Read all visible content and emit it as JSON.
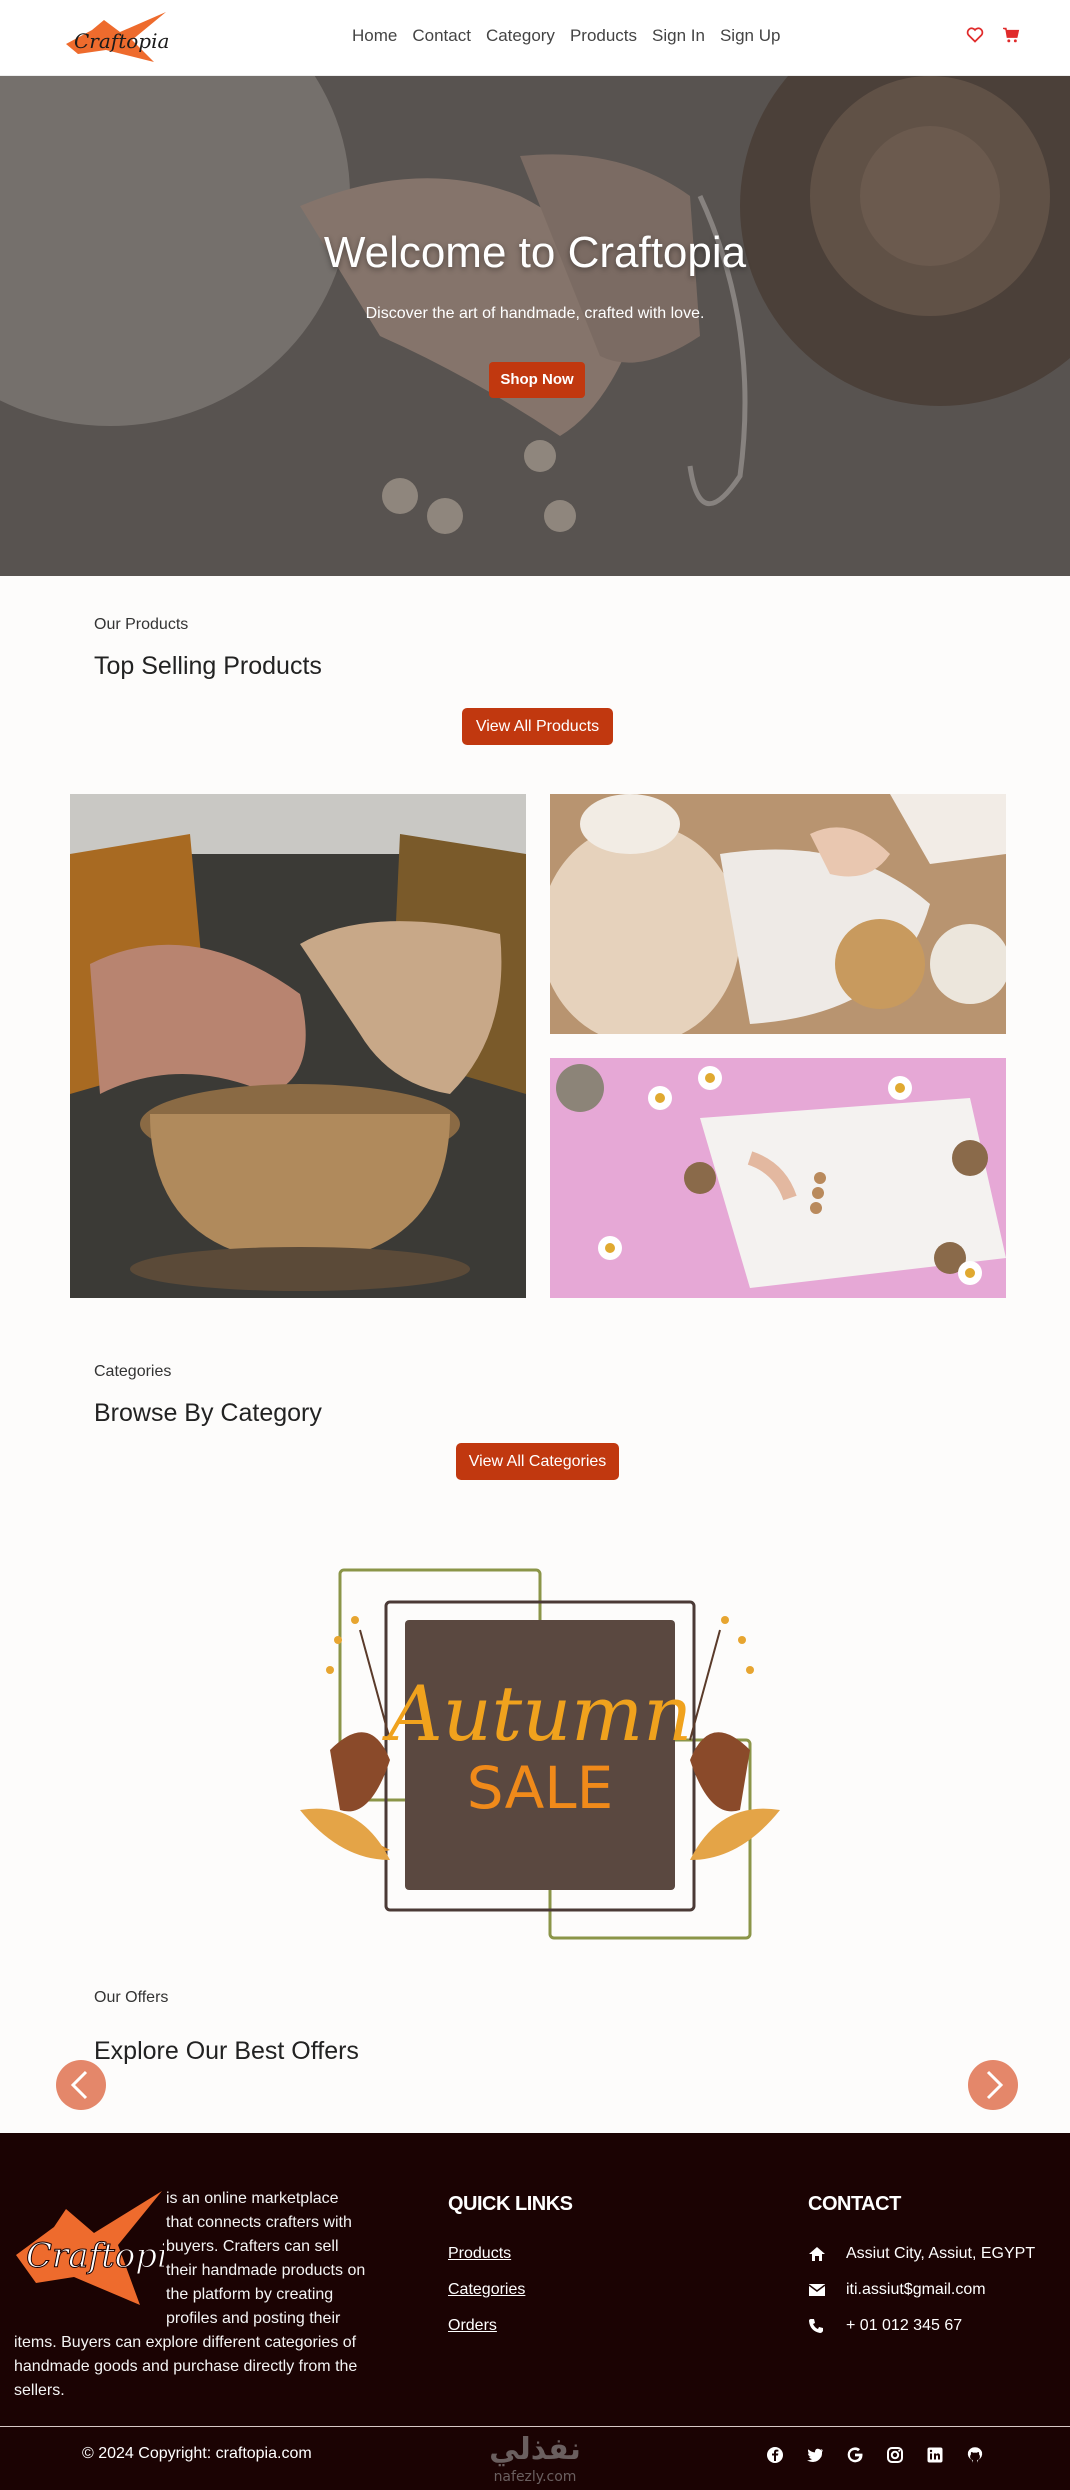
{
  "brand": {
    "name": "Craftopia",
    "accent": "#c1380f",
    "footer_bg": "#1b0303"
  },
  "nav": {
    "links": [
      "Home",
      "Contact",
      "Category",
      "Products",
      "Sign In",
      "Sign Up"
    ],
    "icons": [
      "heart-icon",
      "cart-icon"
    ]
  },
  "hero": {
    "title": "Welcome to Craftopia",
    "subtitle": "Discover the art of handmade, crafted with love.",
    "cta": "Shop Now"
  },
  "products": {
    "eyebrow": "Our Products",
    "title": "Top Selling Products",
    "cta": "View All Products"
  },
  "categories": {
    "eyebrow": "Categories",
    "title": "Browse By Category",
    "cta": "View All Categories"
  },
  "banner": {
    "line1": "Autumn",
    "line2": "SALE"
  },
  "offers": {
    "eyebrow": "Our Offers",
    "title": "Explore Our Best Offers"
  },
  "footer": {
    "logo_text": "Craftopia",
    "about": "is an online marketplace that connects crafters with buyers. Crafters can sell their handmade products on the platform by creating profiles and posting their items. Buyers can explore different categories of handmade goods and purchase directly from the sellers.",
    "quick_links_title": "QUICK LINKS",
    "quick_links": [
      "Products",
      "Categories",
      "Orders"
    ],
    "contact_title": "CONTACT",
    "address": "Assiut City, Assiut, EGYPT",
    "email": "iti.assiut$gmail.com",
    "phone": "+ 01 012 345 67",
    "copyright": "© 2024 Copyright: craftopia.com",
    "socials": [
      "facebook-icon",
      "twitter-icon",
      "google-icon",
      "instagram-icon",
      "linkedin-icon",
      "github-icon"
    ],
    "watermark": "نفذلي",
    "watermark_latin": "nafezly.com"
  }
}
